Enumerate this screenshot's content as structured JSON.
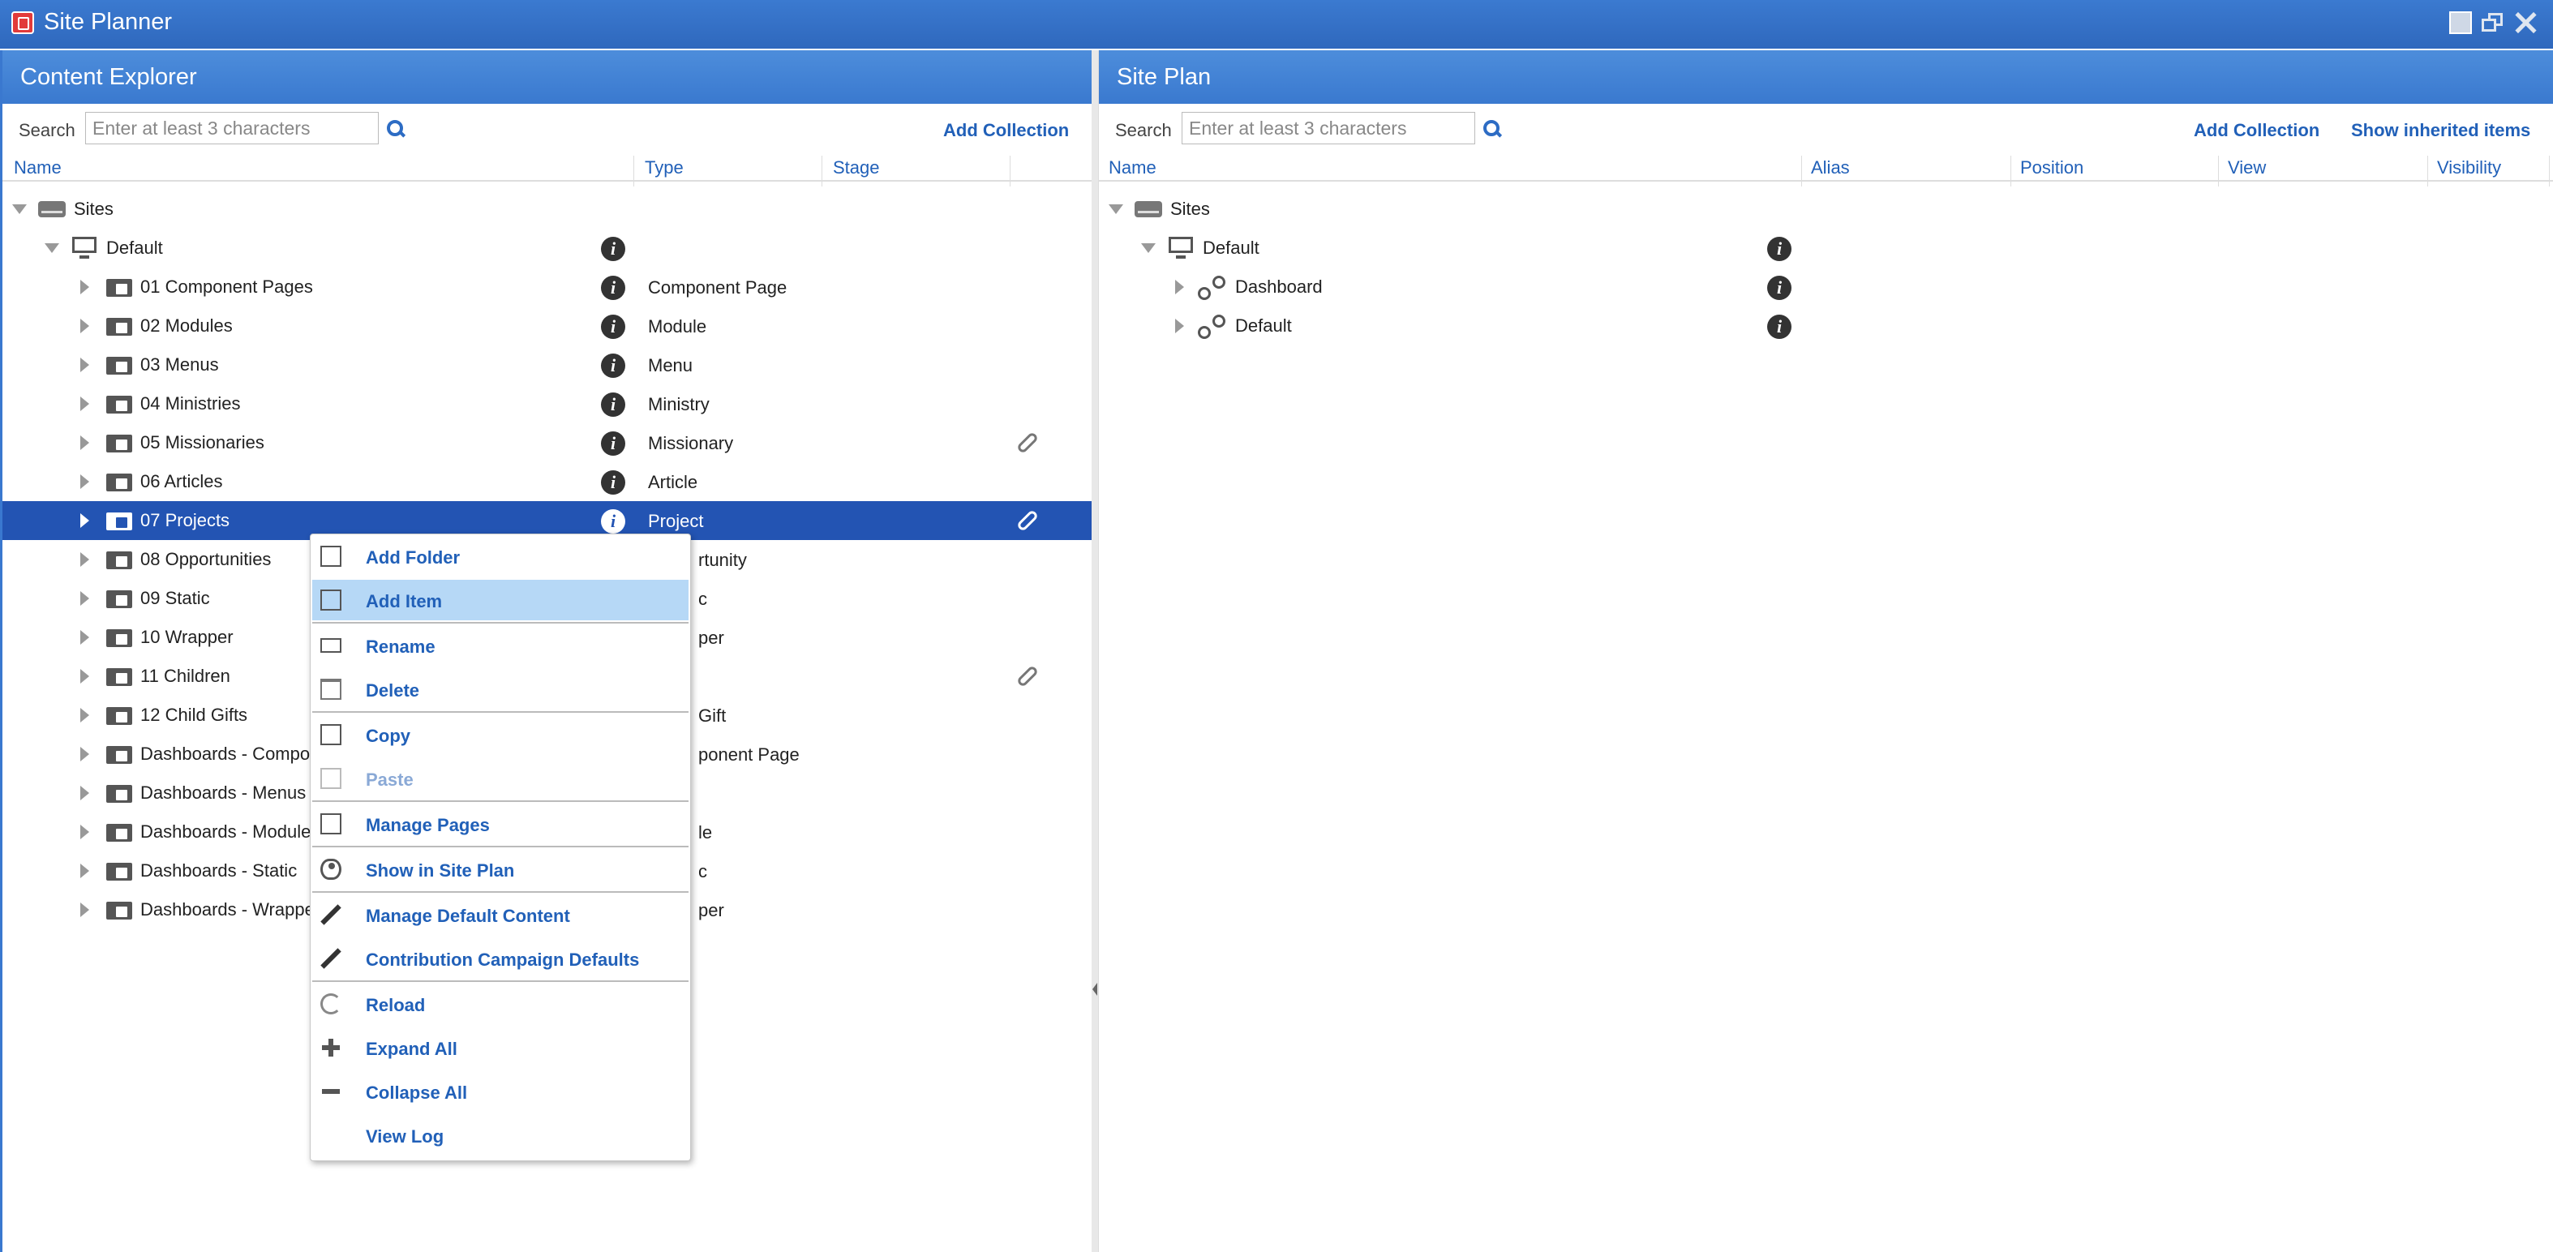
{
  "window": {
    "title": "Site Planner"
  },
  "content_explorer": {
    "header": "Content Explorer",
    "search_label": "Search",
    "search_placeholder": "Enter at least 3 characters",
    "add_collection": "Add Collection",
    "columns": [
      "Name",
      "Type",
      "Stage"
    ],
    "root": "Sites",
    "site": "Default",
    "items": [
      {
        "label": "01 Component Pages",
        "type": "Component Page"
      },
      {
        "label": "02 Modules",
        "type": "Module"
      },
      {
        "label": "03 Menus",
        "type": "Menu"
      },
      {
        "label": "04 Ministries",
        "type": "Ministry"
      },
      {
        "label": "05 Missionaries",
        "type": "Missionary"
      },
      {
        "label": "06 Articles",
        "type": "Article"
      },
      {
        "label": "07 Projects",
        "type": "Project"
      },
      {
        "label": "08 Opportunities",
        "type": "rtunity"
      },
      {
        "label": "09 Static",
        "type": "c"
      },
      {
        "label": "10 Wrapper",
        "type": "per"
      },
      {
        "label": "11 Children",
        "type": ""
      },
      {
        "label": "12 Child Gifts",
        "type": "Gift"
      },
      {
        "label": "Dashboards - Compo",
        "type": "ponent Page"
      },
      {
        "label": "Dashboards - Menus",
        "type": ""
      },
      {
        "label": "Dashboards - Module",
        "type": "le"
      },
      {
        "label": "Dashboards - Static",
        "type": "c"
      },
      {
        "label": "Dashboards - Wrappe",
        "type": "per"
      }
    ]
  },
  "context_menu": {
    "items": [
      "Add Folder",
      "Add Item",
      "Rename",
      "Delete",
      "Copy",
      "Paste",
      "Manage Pages",
      "Show in Site Plan",
      "Manage Default Content",
      "Contribution Campaign Defaults",
      "Reload",
      "Expand All",
      "Collapse All",
      "View Log"
    ]
  },
  "site_plan": {
    "header": "Site Plan",
    "search_label": "Search",
    "search_placeholder": "Enter at least 3 characters",
    "add_collection": "Add Collection",
    "show_inherited": "Show inherited items",
    "columns": [
      "Name",
      "Alias",
      "Position",
      "View",
      "Visibility"
    ],
    "root": "Sites",
    "site": "Default",
    "items": [
      "Dashboard",
      "Default"
    ]
  }
}
